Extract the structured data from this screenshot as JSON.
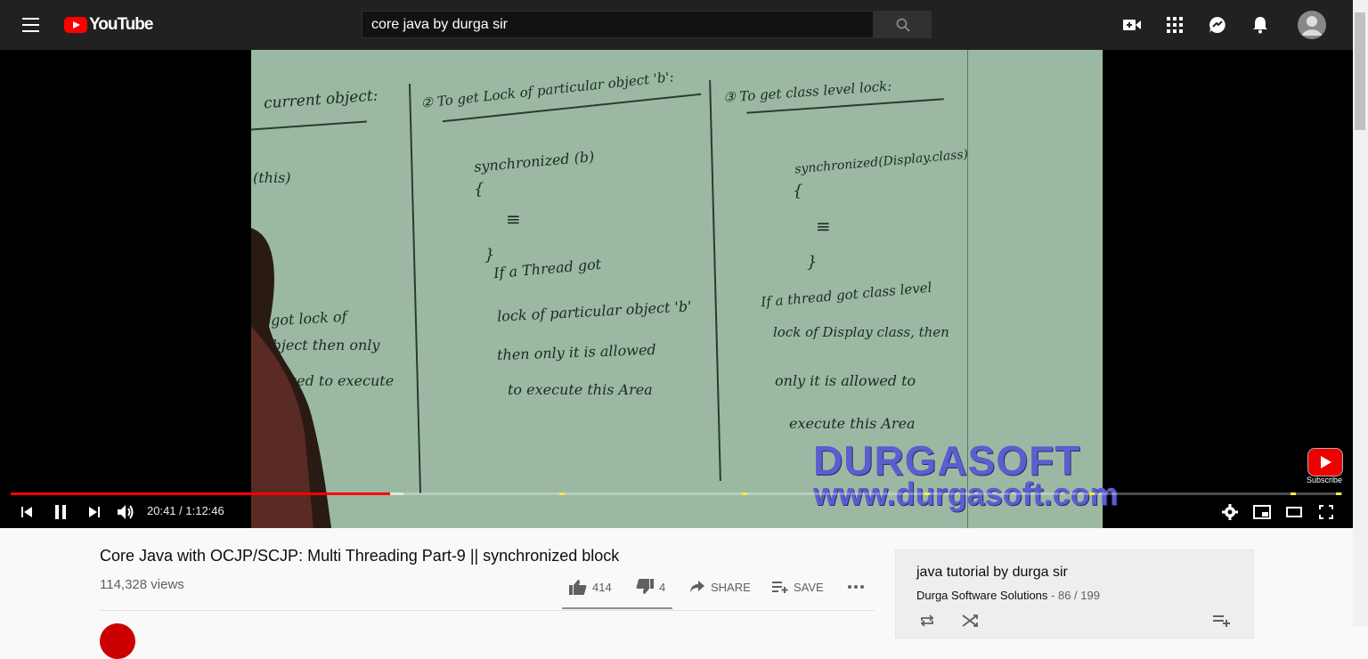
{
  "header": {
    "logo_text": "YouTube",
    "search_value": "core java by durga sir",
    "icons": [
      "menu-icon",
      "search-icon",
      "create-video-icon",
      "apps-icon",
      "messages-icon",
      "notifications-icon",
      "avatar-icon"
    ]
  },
  "video": {
    "board": {
      "col1_heading": "current object:",
      "col1_code": "(this)",
      "col1_line1": "got lock of",
      "col1_line2": "object then only",
      "col1_line3": "allowed to execute",
      "col2_heading": "② To get Lock of particular object 'b':",
      "col2_code": "synchronized (b)",
      "col2_brace_open": "{",
      "col2_dots": "≡",
      "col2_brace_close": "}",
      "col2_line1": "If a Thread got",
      "col2_line2": "lock of particular object 'b'",
      "col2_line3": "then only it is allowed",
      "col2_line4": "to execute this Area",
      "col3_heading": "③ To get class level lock:",
      "col3_code": "synchronized(Display.class)",
      "col3_brace_open": "{",
      "col3_dots": "≡",
      "col3_brace_close": "}",
      "col3_line1": "If a thread got class level",
      "col3_line2": "lock of Display class, then",
      "col3_line3": "only it is allowed to",
      "col3_line4": "execute this Area"
    },
    "watermark_title": "DURGASOFT",
    "watermark_url": "www.durgasoft.com",
    "subscribe_label": "Subscribe",
    "progress": {
      "played_fraction": 0.285,
      "buffered_fraction": 0.295
    },
    "time_display": "20:41 / 1:12:46",
    "controls": [
      "previous-icon",
      "pause-icon",
      "next-icon",
      "volume-icon",
      "settings-icon",
      "miniplayer-icon",
      "theater-icon",
      "fullscreen-icon"
    ],
    "marker_color": "#ffeb3b",
    "progress_color": "#ff0000"
  },
  "info": {
    "title": "Core Java with OCJP/SCJP: Multi Threading Part-9 || synchronized block",
    "views": "114,328 views",
    "likes": "414",
    "dislikes": "4",
    "share_label": "SHARE",
    "save_label": "SAVE"
  },
  "playlist": {
    "title": "java tutorial by durga sir",
    "owner": "Durga Software Solutions",
    "count": " - 86 / 199"
  }
}
